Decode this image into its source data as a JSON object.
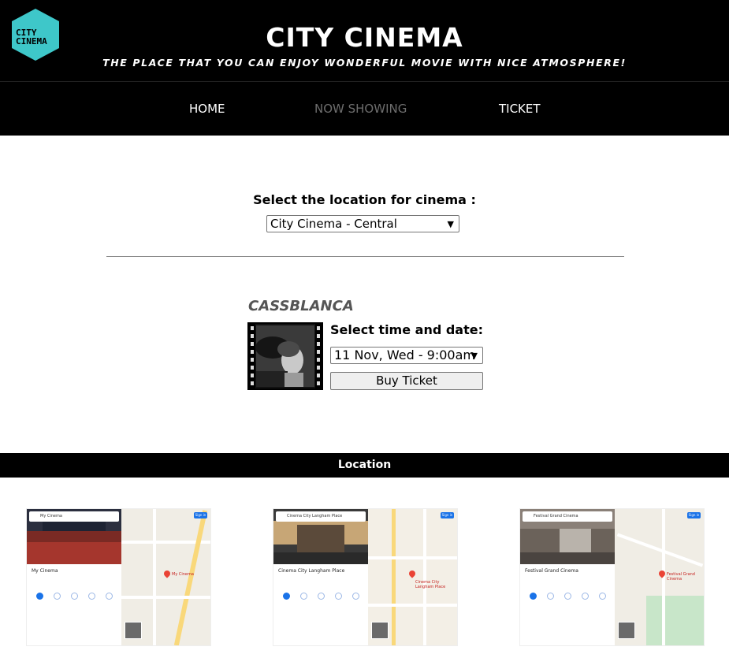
{
  "header": {
    "logo_text": "CITY CINEMA",
    "title": "CITY CINEMA",
    "tagline": "THE PLACE THAT YOU CAN ENJOY WONDERFUL MOVIE WITH NICE ATMOSPHERE!",
    "logo_color": "#3ec7c9"
  },
  "nav": {
    "items": [
      {
        "label": "HOME",
        "active": true
      },
      {
        "label": "NOW SHOWING",
        "active": false
      },
      {
        "label": "TICKET",
        "active": true
      }
    ]
  },
  "location_selector": {
    "label": "Select the location for cinema :",
    "selected": "City Cinema - Central"
  },
  "movie": {
    "title": "CASSBLANCA",
    "time_label": "Select time and date:",
    "selected_time": "11 Nov, Wed - 9:00am",
    "buy_label": "Buy Ticket"
  },
  "location_section": {
    "heading": "Location",
    "maps": [
      {
        "search": "My Cinema",
        "place": "My Cinema",
        "pin_label": "My Cinema"
      },
      {
        "search": "Cinema City Langham Place",
        "place": "Cinema City Langham Place",
        "pin_label": "Cinema City Langham Place"
      },
      {
        "search": "Festival Grand Cinema",
        "place": "Festival Grand Cinema",
        "pin_label": "Festival Grand Cinema"
      }
    ],
    "sign_in": "Sign in"
  }
}
